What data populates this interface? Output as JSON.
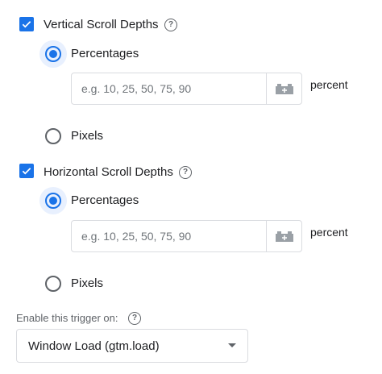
{
  "vertical": {
    "checkbox_label": "Vertical Scroll Depths",
    "checked": true,
    "options": {
      "percentages_label": "Percentages",
      "pixels_label": "Pixels",
      "selected": "Percentages"
    },
    "input": {
      "value": "",
      "placeholder": "e.g. 10, 25, 50, 75, 90"
    },
    "unit": "percent",
    "help_icon": "help-icon",
    "variable_icon": "variable-brick-icon"
  },
  "horizontal": {
    "checkbox_label": "Horizontal Scroll Depths",
    "checked": true,
    "options": {
      "percentages_label": "Percentages",
      "pixels_label": "Pixels",
      "selected": "Percentages"
    },
    "input": {
      "value": "",
      "placeholder": "e.g. 10, 25, 50, 75, 90"
    },
    "unit": "percent",
    "help_icon": "help-icon",
    "variable_icon": "variable-brick-icon"
  },
  "trigger": {
    "label": "Enable this trigger on:",
    "selected": "Window Load (gtm.load)"
  },
  "colors": {
    "accent": "#1a73e8",
    "icon_gray": "#5f6368",
    "border": "#dadce0"
  }
}
